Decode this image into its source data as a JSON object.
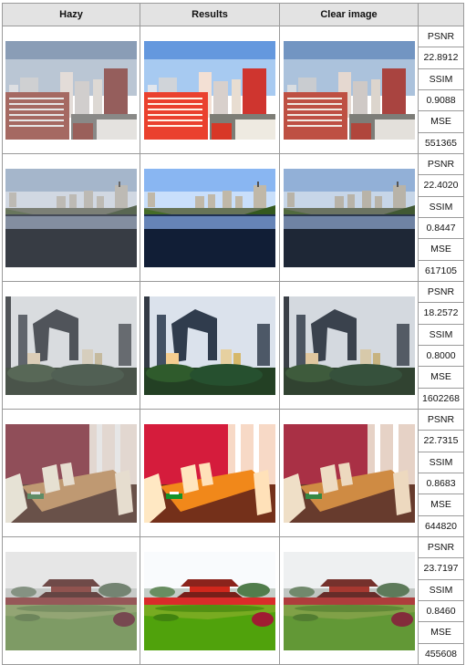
{
  "headers": {
    "hazy": "Hazy",
    "results": "Results",
    "clear": "Clear image",
    "metrics": ""
  },
  "rows": [
    {
      "scene": "city-buildings",
      "psnr_label": "PSNR",
      "psnr": "22.8912",
      "ssim_label": "SSIM",
      "ssim": "0.9088",
      "mse_label": "MSE",
      "mse": "551365"
    },
    {
      "scene": "river-city",
      "psnr_label": "PSNR",
      "psnr": "22.4020",
      "ssim_label": "SSIM",
      "ssim": "0.8447",
      "mse_label": "MSE",
      "mse": "617105"
    },
    {
      "scene": "cctv-tower",
      "psnr_label": "PSNR",
      "psnr": "18.2572",
      "ssim_label": "SSIM",
      "ssim": "0.8000",
      "mse_label": "MSE",
      "mse": "1602268"
    },
    {
      "scene": "dining-room",
      "psnr_label": "PSNR",
      "psnr": "22.7315",
      "ssim_label": "SSIM",
      "ssim": "0.8683",
      "mse_label": "MSE",
      "mse": "644820"
    },
    {
      "scene": "gate-garden",
      "psnr_label": "PSNR",
      "psnr": "23.7197",
      "ssim_label": "SSIM",
      "ssim": "0.8460",
      "mse_label": "MSE",
      "mse": "455608"
    }
  ]
}
